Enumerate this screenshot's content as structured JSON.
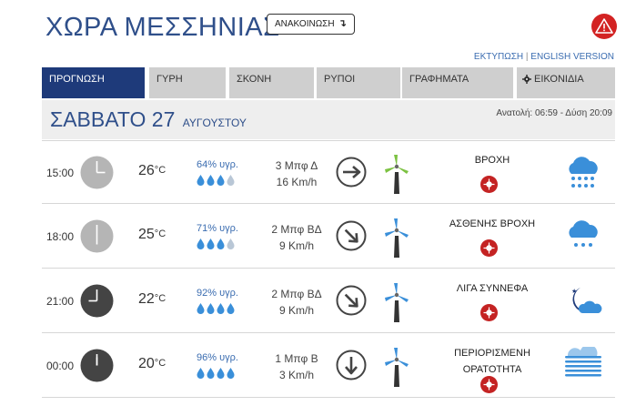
{
  "header": {
    "title": "ΧΩΡΑ ΜΕΣΣΗΝΙΑΣ",
    "announce_label": "ΑΝΑΚΟΙΝΩΣΗ",
    "announce_icon": "arrow-turn-icon",
    "alert_icon": "warning-triangle-icon"
  },
  "top_links": {
    "print": "ΕΚΤΥΠΩΣΗ",
    "separator": "|",
    "english": "ENGLISH VERSION"
  },
  "tabs": [
    {
      "label": "ΠΡΟΓΝΩΣΗ",
      "active": true
    },
    {
      "label": "ΓΥΡΗ"
    },
    {
      "label": "ΣΚΟΝΗ"
    },
    {
      "label": "ΡΥΠΟΙ"
    },
    {
      "label": "ΓΡΑΦΗΜΑΤΑ"
    },
    {
      "label": "ΕΙΚΟΝΙΔΙΑ",
      "icon": "gear-icon"
    }
  ],
  "day": {
    "weekday_date": "ΣΑΒΒΑΤΟ 27",
    "month": "ΑΥΓΟΥΣΤΟΥ",
    "sun_times": "Ανατολή: 06:59 - Δύση 20:09"
  },
  "forecast": [
    {
      "time": "15:00",
      "temp": "26",
      "unit": "°C",
      "humidity": "64% υγρ.",
      "drops_filled": 3,
      "wind_bft": "3 Μπφ Δ",
      "wind_speed": "16 Km/h",
      "wind_icon": "arrow-right-icon",
      "turbine": "green",
      "condition_lines": [
        "ΒΡΟΧΗ"
      ],
      "weather_icon": "rain-cloud-icon",
      "clock_theme": "day"
    },
    {
      "time": "18:00",
      "temp": "25",
      "unit": "°C",
      "humidity": "71% υγρ.",
      "drops_filled": 3,
      "wind_bft": "2 Μπφ ΒΔ",
      "wind_speed": "9 Km/h",
      "wind_icon": "arrow-down-right-icon",
      "turbine": "blue",
      "condition_lines": [
        "ΑΣΘΕΝΗΣ ΒΡΟΧΗ"
      ],
      "weather_icon": "light-rain-cloud-icon",
      "clock_theme": "day"
    },
    {
      "time": "21:00",
      "temp": "22",
      "unit": "°C",
      "humidity": "92% υγρ.",
      "drops_filled": 4,
      "wind_bft": "2 Μπφ ΒΔ",
      "wind_speed": "9 Km/h",
      "wind_icon": "arrow-down-right-icon",
      "turbine": "blue",
      "condition_lines": [
        "ΛΙΓΑ ΣΥΝΝΕΦΑ"
      ],
      "weather_icon": "moon-cloud-icon",
      "clock_theme": "night"
    },
    {
      "time": "00:00",
      "temp": "20",
      "unit": "°C",
      "humidity": "96% υγρ.",
      "drops_filled": 4,
      "wind_bft": "1 Μπφ Β",
      "wind_speed": "3 Km/h",
      "wind_icon": "arrow-down-icon",
      "turbine": "blue",
      "condition_lines": [
        "ΠΕΡΙΟΡΙΣΜΕΝΗ",
        "ΟΡΑΤΟΤΗΤΑ"
      ],
      "weather_icon": "fog-icon",
      "clock_theme": "night"
    }
  ],
  "colors": {
    "brand": "#2f4f8a",
    "active_tab": "#1e3a7a",
    "alert": "#d32323",
    "drop": "#3a8fd9",
    "icon_blue": "#3a8fd9"
  }
}
